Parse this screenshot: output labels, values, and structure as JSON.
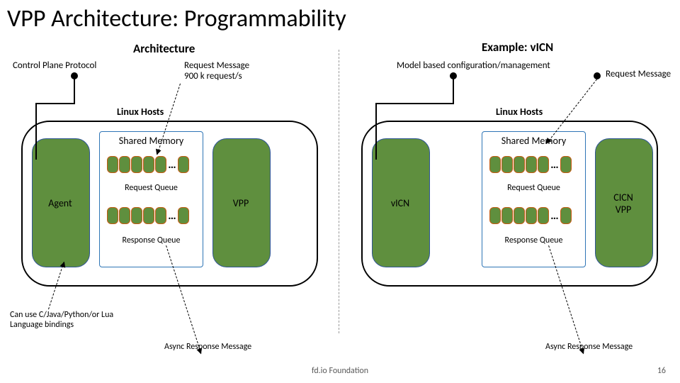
{
  "title": "VPP Architecture: Programmability",
  "left": {
    "heading": "Architecture",
    "control_plane": "Control Plane Protocol",
    "req_msg": "Request Message\n900 k request/s",
    "host_label": "Linux Hosts",
    "shared_mem": "Shared Memory",
    "req_q": "Request Queue",
    "resp_q": "Response Queue",
    "agent": "Agent",
    "vpp": "VPP",
    "bindings": "Can use C/Java/Python/or Lua\nLanguage bindings",
    "async": "Async Response Message"
  },
  "right": {
    "heading": "Example: vICN",
    "model": "Model based configuration/management",
    "req_msg": "Request Message",
    "host_label": "Linux Hosts",
    "shared_mem": "Shared Memory",
    "req_q": "Request Queue",
    "resp_q": "Response Queue",
    "agent": "vICN",
    "vpp": "CICN\nVPP",
    "async": "Async Response Message"
  },
  "ellipsis": "…",
  "footer": "fd.io Foundation",
  "slide": "16"
}
